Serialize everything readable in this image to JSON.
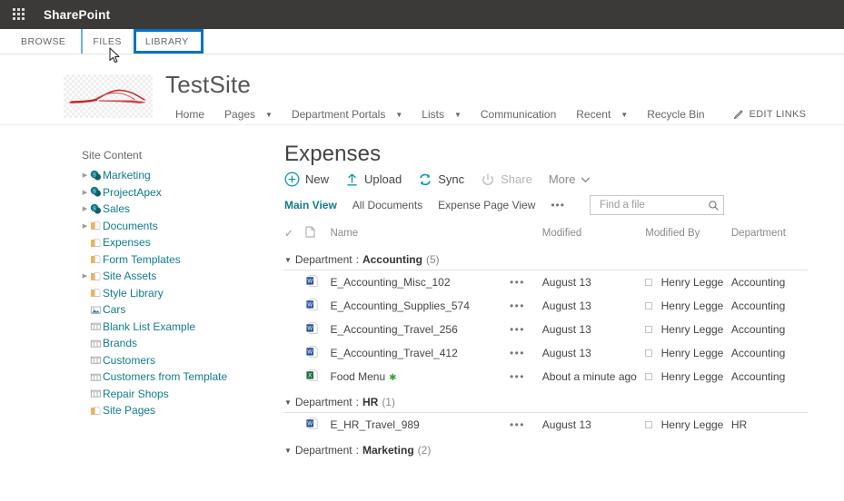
{
  "suite": {
    "waffle_icon": "app-launcher-icon",
    "title": "SharePoint"
  },
  "ribbon": {
    "tabs": [
      {
        "label": "BROWSE",
        "state": "normal"
      },
      {
        "label": "FILES",
        "state": "normal"
      },
      {
        "label": "LIBRARY",
        "state": "focused"
      }
    ]
  },
  "site": {
    "logo_icon": "car-logo-icon",
    "title": "TestSite",
    "nav": [
      {
        "label": "Home",
        "caret": false
      },
      {
        "label": "Pages",
        "caret": true
      },
      {
        "label": "Department Portals",
        "caret": true
      },
      {
        "label": "Lists",
        "caret": true
      },
      {
        "label": "Communication",
        "caret": false
      },
      {
        "label": "Recent",
        "caret": true
      },
      {
        "label": "Recycle Bin",
        "caret": false
      }
    ],
    "edit_links": "EDIT LINKS",
    "edit_links_icon": "pencil-icon"
  },
  "quicklaunch": {
    "heading": "Site Content",
    "items": [
      {
        "label": "Marketing",
        "icon": "sharepoint-site-icon",
        "twisty": true
      },
      {
        "label": "ProjectApex",
        "icon": "sharepoint-site-icon",
        "twisty": true
      },
      {
        "label": "Sales",
        "icon": "sharepoint-site-icon",
        "twisty": true
      },
      {
        "label": "Documents",
        "icon": "document-library-icon",
        "twisty": true
      },
      {
        "label": "Expenses",
        "icon": "document-library-icon",
        "twisty": false
      },
      {
        "label": "Form Templates",
        "icon": "document-library-icon",
        "twisty": false
      },
      {
        "label": "Site Assets",
        "icon": "document-library-icon",
        "twisty": true
      },
      {
        "label": "Style Library",
        "icon": "document-library-icon",
        "twisty": false
      },
      {
        "label": "Cars",
        "icon": "picture-library-icon",
        "twisty": false
      },
      {
        "label": "Blank List Example",
        "icon": "list-icon",
        "twisty": false
      },
      {
        "label": "Brands",
        "icon": "list-icon",
        "twisty": false
      },
      {
        "label": "Customers",
        "icon": "list-icon",
        "twisty": false
      },
      {
        "label": "Customers from Template",
        "icon": "list-icon",
        "twisty": false
      },
      {
        "label": "Repair Shops",
        "icon": "list-icon",
        "twisty": false
      },
      {
        "label": "Site Pages",
        "icon": "document-library-icon",
        "twisty": false
      }
    ]
  },
  "library": {
    "title": "Expenses",
    "commands": [
      {
        "label": "New",
        "icon": "circle-plus-icon",
        "disabled": false
      },
      {
        "label": "Upload",
        "icon": "upload-arrow-icon",
        "disabled": false
      },
      {
        "label": "Sync",
        "icon": "sync-icon",
        "disabled": false
      },
      {
        "label": "Share",
        "icon": "share-icon",
        "disabled": true
      },
      {
        "label": "More",
        "icon": "chevron-down-icon",
        "disabled": false
      }
    ],
    "views": [
      {
        "label": "Main View",
        "active": true
      },
      {
        "label": "All Documents",
        "active": false
      },
      {
        "label": "Expense Page View",
        "active": false
      }
    ],
    "views_overflow": "•••",
    "search": {
      "placeholder": "Find a file",
      "value": "",
      "icon": "search-icon"
    },
    "columns": {
      "check": "✓",
      "type": "document-icon",
      "name": "Name",
      "modified": "Modified",
      "modified_by": "Modified By",
      "department": "Department"
    },
    "groups": [
      {
        "field": "Department",
        "separator": " : ",
        "value": "Accounting",
        "count": "(5)",
        "rows": [
          {
            "icon": "word-doc-icon",
            "name": "E_Accounting_Misc_102",
            "new": false,
            "ellipsis": "•••",
            "modified": "August 13",
            "modified_by": "Henry Legge",
            "department": "Accounting"
          },
          {
            "icon": "word-doc-icon",
            "name": "E_Accounting_Supplies_574",
            "new": false,
            "ellipsis": "•••",
            "modified": "August 13",
            "modified_by": "Henry Legge",
            "department": "Accounting"
          },
          {
            "icon": "word-doc-icon",
            "name": "E_Accounting_Travel_256",
            "new": false,
            "ellipsis": "•••",
            "modified": "August 13",
            "modified_by": "Henry Legge",
            "department": "Accounting"
          },
          {
            "icon": "word-doc-icon",
            "name": "E_Accounting_Travel_412",
            "new": false,
            "ellipsis": "•••",
            "modified": "August 13",
            "modified_by": "Henry Legge",
            "department": "Accounting"
          },
          {
            "icon": "excel-doc-icon",
            "name": "Food Menu",
            "new": true,
            "ellipsis": "•••",
            "modified": "About a minute ago",
            "modified_by": "Henry Legge",
            "department": "Accounting"
          }
        ]
      },
      {
        "field": "Department",
        "separator": " : ",
        "value": "HR",
        "count": "(1)",
        "rows": [
          {
            "icon": "word-doc-icon",
            "name": "E_HR_Travel_989",
            "new": false,
            "ellipsis": "•••",
            "modified": "August 13",
            "modified_by": "Henry Legge",
            "department": "HR"
          }
        ]
      },
      {
        "field": "Department",
        "separator": " : ",
        "value": "Marketing",
        "count": "(2)",
        "rows": []
      }
    ],
    "new_badge": "✱"
  },
  "colors": {
    "suitebar_bg": "#3b3a39",
    "accent_teal": "#0f7c8a",
    "focus_blue": "#0072c6",
    "link_teal": "#0f7c8a",
    "word_blue": "#2b579a",
    "excel_green": "#217346",
    "logo_red": "#c0282d"
  }
}
